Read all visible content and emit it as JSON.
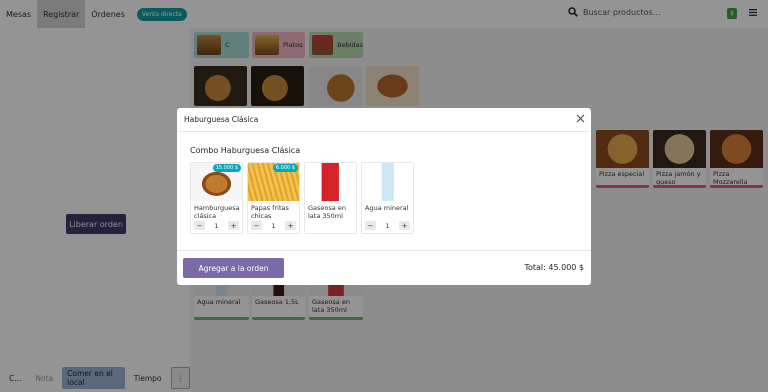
{
  "nav": {
    "tables": "Mesas",
    "register": "Registrar",
    "orders": "Órdenes",
    "badge": "Venta directa",
    "search_placeholder": "Buscar productos...",
    "green_badge": "$"
  },
  "left": {
    "release_order": "Liberar orden"
  },
  "bottom": {
    "c": "C...",
    "note": "Nota",
    "dine_in": "Comer en el local",
    "time": "Tiempo",
    "more": "⋮"
  },
  "categories": [
    {
      "label": "C",
      "color": "#a8dcd6"
    },
    {
      "label": "Platos",
      "color": "#f7b7c8"
    },
    {
      "label": "Bebidas",
      "color": "#b5dcb0"
    }
  ],
  "background_products": [
    {
      "label": "Pizza especial"
    },
    {
      "label": "Pizza jamón y queso"
    },
    {
      "label": "Pizza Mozzarella"
    },
    {
      "label": "Agua mineral"
    },
    {
      "label": "Gaseosa 1,5L"
    },
    {
      "label": "Gaseosa en lata 350ml"
    }
  ],
  "modal": {
    "title": "Haburguesa Clásica",
    "combo_title": "Combo Haburguesa Clásica",
    "items": [
      {
        "name": "Hamburguesa clásica",
        "price": "15.000 $",
        "qty": "1"
      },
      {
        "name": "Papas fritas chicas",
        "price": "6.000 $",
        "qty": "1"
      },
      {
        "name": "Gaseosa en lata 350ml",
        "price": "",
        "qty": ""
      },
      {
        "name": "Agua mineral",
        "price": "",
        "qty": "1"
      }
    ],
    "add_button": "Agregar a la orden",
    "total": "Total: 45.000 $"
  },
  "colors": {
    "primary": "#7a6aa8",
    "badge": "#0ea5b4",
    "accent_pink": "#e35a8a"
  }
}
